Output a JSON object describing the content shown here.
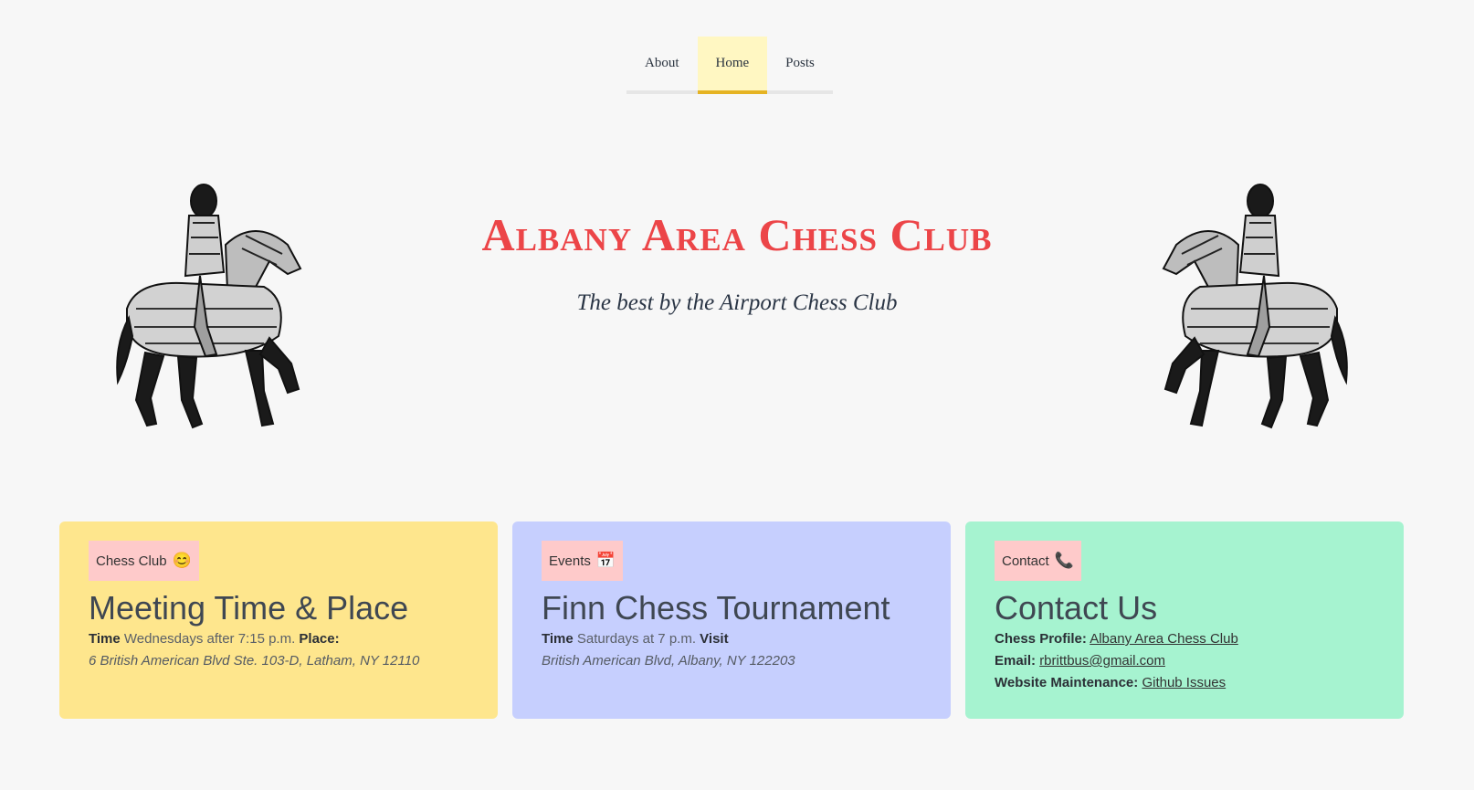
{
  "nav": {
    "items": [
      {
        "label": "About",
        "active": false
      },
      {
        "label": "Home",
        "active": true
      },
      {
        "label": "Posts",
        "active": false
      }
    ]
  },
  "hero": {
    "title": "Albany Area Chess Club",
    "subtitle": "The best by the Airport Chess Club"
  },
  "cards": {
    "meeting": {
      "badge": "Chess Club",
      "badge_icon": "😊",
      "heading": "Meeting Time & Place",
      "time_label": "Time",
      "time_value": "Wednesdays after 7:15 p.m.",
      "place_label": "Place:",
      "address": "6 British American Blvd Ste. 103-D, Latham, NY 12110"
    },
    "events": {
      "badge": "Events",
      "badge_icon": "📅",
      "heading": "Finn Chess Tournament",
      "time_label": "Time",
      "time_value": "Saturdays at 7 p.m.",
      "visit_label": "Visit",
      "address": "British American Blvd, Albany, NY 122203"
    },
    "contact": {
      "badge": "Contact",
      "badge_icon": "📞",
      "heading": "Contact Us",
      "profile_label": "Chess Profile:",
      "profile_link": "Albany Area Chess Club",
      "email_label": "Email:",
      "email_link": "rbrittbus@gmail.com",
      "maint_label": "Website Maintenance:",
      "maint_link": "Github Issues"
    }
  },
  "colors": {
    "title": "#ec4548",
    "card_yellow": "#fee68d",
    "card_blue": "#c6cffe",
    "card_green": "#a6f3d0",
    "badge": "#fecaca",
    "nav_active": "#fff7c2"
  }
}
